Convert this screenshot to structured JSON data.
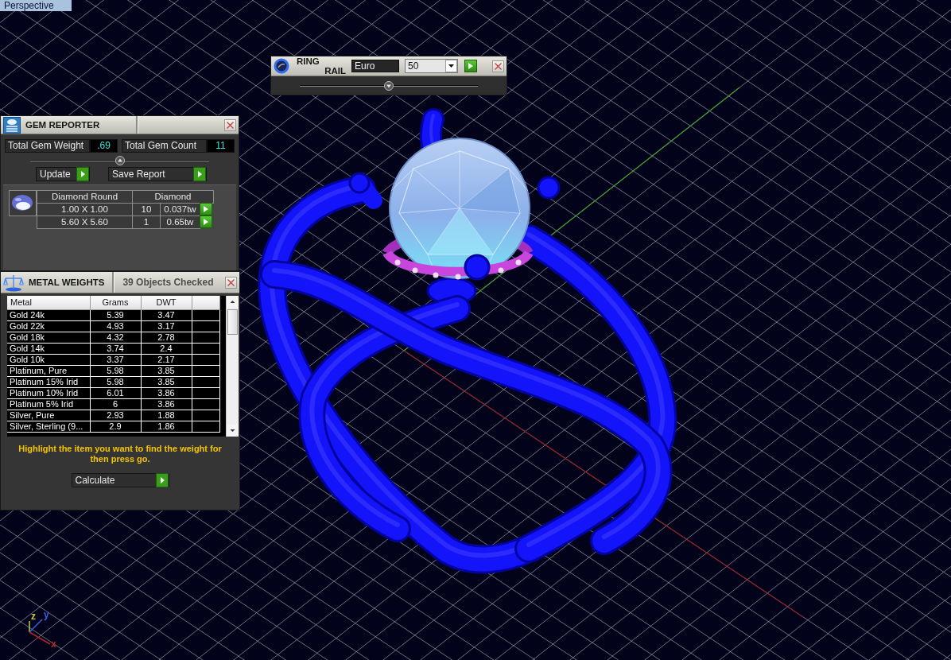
{
  "viewport": {
    "label": "Perspective",
    "axes": [
      {
        "kind": "z",
        "label": "z"
      },
      {
        "kind": "y",
        "label": "y"
      },
      {
        "kind": "x",
        "label": "x"
      }
    ]
  },
  "ring_rail": {
    "title": [
      "RING",
      "RAIL"
    ],
    "size_system": "Euro",
    "size": "50",
    "slider": {
      "level": 0.5
    }
  },
  "gem_reporter": {
    "title": "GEM REPORTER",
    "stats": [
      {
        "label": "Total Gem Weight",
        "value": ".69"
      },
      {
        "label": "Total Gem Count",
        "value": "11"
      }
    ],
    "slider": {
      "level": 0.5
    },
    "buttons": [
      "Update",
      "Save Report"
    ],
    "gem_table": {
      "columns": [
        "Diamond Round",
        "Diamond"
      ],
      "rows": [
        {
          "size": "1.00 X 1.00",
          "count": "10",
          "weight": "0.037tw"
        },
        {
          "size": "5.60 X 5.60",
          "count": "1",
          "weight": "0.65tw"
        }
      ]
    }
  },
  "metal_weights": {
    "title": "METAL WEIGHTS",
    "status": "39 Objects Checked",
    "columns": [
      "Metal",
      "Grams",
      "DWT"
    ],
    "rows": [
      {
        "metal": "Gold 24k",
        "grams": "5.39",
        "dwt": "3.47",
        "selected": false
      },
      {
        "metal": "Gold 22k",
        "grams": "4.93",
        "dwt": "3.17",
        "selected": false
      },
      {
        "metal": "Gold 18k",
        "grams": "4.32",
        "dwt": "2.78",
        "selected": false
      },
      {
        "metal": "Gold 14k",
        "grams": "3.74",
        "dwt": "2.4",
        "selected": false
      },
      {
        "metal": "Gold 10k",
        "grams": "3.37",
        "dwt": "2.17",
        "selected": false
      },
      {
        "metal": "Platinum, Pure",
        "grams": "5.98",
        "dwt": "3.85",
        "selected": false
      },
      {
        "metal": "Platinum 15% Irid",
        "grams": "5.98",
        "dwt": "3.85",
        "selected": false
      },
      {
        "metal": "Platinum 10% Irid",
        "grams": "6.01",
        "dwt": "3.86",
        "selected": false
      },
      {
        "metal": "Platinum 5% Irid",
        "grams": "6",
        "dwt": "3.86",
        "selected": false
      },
      {
        "metal": "Silver, Pure",
        "grams": "2.93",
        "dwt": "1.88",
        "selected": false
      },
      {
        "metal": "Silver, Sterling (9...",
        "grams": "2.9",
        "dwt": "1.86",
        "selected": false
      }
    ],
    "instruction": "Highlight the item you want to find the weight for then press go.",
    "button": "Calculate"
  }
}
